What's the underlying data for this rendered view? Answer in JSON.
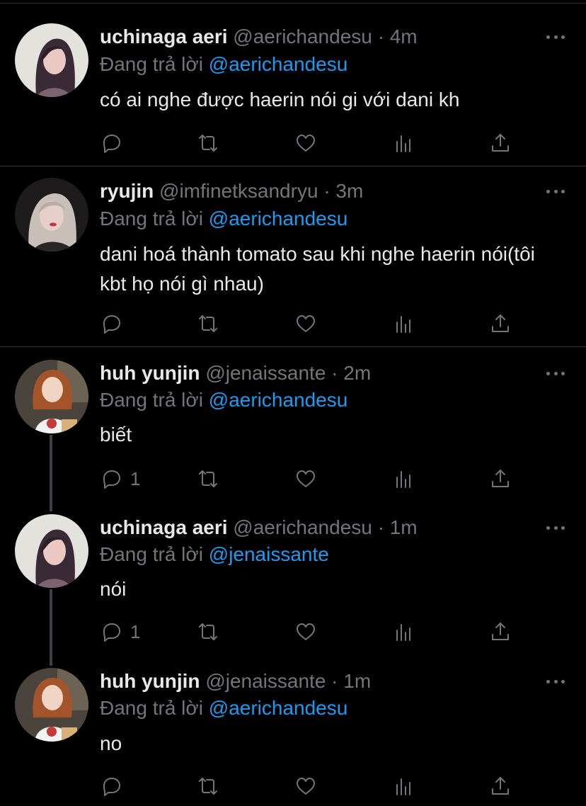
{
  "colors": {
    "background": "#000000",
    "text": "#e7e9ea",
    "secondary": "#71767b",
    "link": "#1d9bf0",
    "divider": "#2f3336"
  },
  "replying_prefix": "Đang trả lời",
  "tweets": [
    {
      "name": "uchinaga aeri",
      "handle": "@aerichandesu",
      "dot": "·",
      "time": "4m",
      "reply_to": "@aerichandesu",
      "text": "có ai nghe được haerin nói gi với dani kh",
      "reply_count": "",
      "avatar": "avatar-aeri"
    },
    {
      "name": "ryujin",
      "handle": "@imfinetksandryu",
      "dot": "·",
      "time": "3m",
      "reply_to": "@aerichandesu",
      "text": "dani hoá thành tomato sau khi nghe haerin nói(tôi kbt họ nói gì nhau)",
      "reply_count": "",
      "avatar": "avatar-ryujin"
    },
    {
      "name": "huh yunjin",
      "handle": "@jenaissante",
      "dot": "·",
      "time": "2m",
      "reply_to": "@aerichandesu",
      "text": "biết",
      "reply_count": "1",
      "avatar": "avatar-yunjin"
    },
    {
      "name": "uchinaga aeri",
      "handle": "@aerichandesu",
      "dot": "·",
      "time": "1m",
      "reply_to": "@jenaissante",
      "text": "nói",
      "reply_count": "1",
      "avatar": "avatar-aeri"
    },
    {
      "name": "huh yunjin",
      "handle": "@jenaissante",
      "dot": "·",
      "time": "1m",
      "reply_to": "@aerichandesu",
      "text": "no",
      "reply_count": "",
      "avatar": "avatar-yunjin"
    }
  ],
  "icons": [
    "reply-icon",
    "retweet-icon",
    "like-icon",
    "analytics-icon",
    "share-icon",
    "more-icon"
  ]
}
